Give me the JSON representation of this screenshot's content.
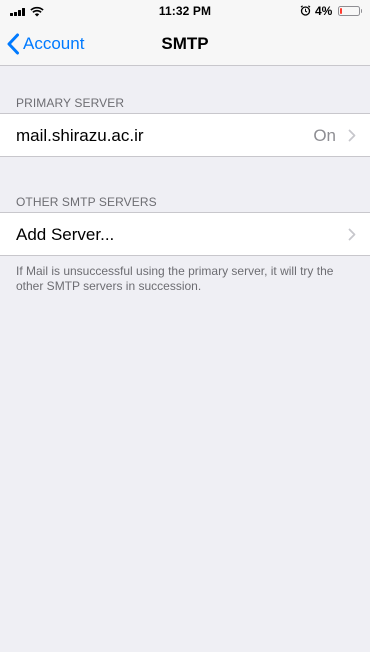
{
  "status_bar": {
    "time": "11:32 PM",
    "battery_percent": "4%",
    "battery_level": 0.04
  },
  "nav": {
    "back_label": "Account",
    "title": "SMTP"
  },
  "primary_server": {
    "header": "PRIMARY SERVER",
    "server_name": "mail.shirazu.ac.ir",
    "status": "On"
  },
  "other_servers": {
    "header": "OTHER SMTP SERVERS",
    "add_label": "Add Server...",
    "footer": "If Mail is unsuccessful using the primary server, it will try the other SMTP servers in succession."
  },
  "colors": {
    "accent": "#007aff",
    "background": "#efeff4",
    "battery_low": "#ff3b30"
  }
}
